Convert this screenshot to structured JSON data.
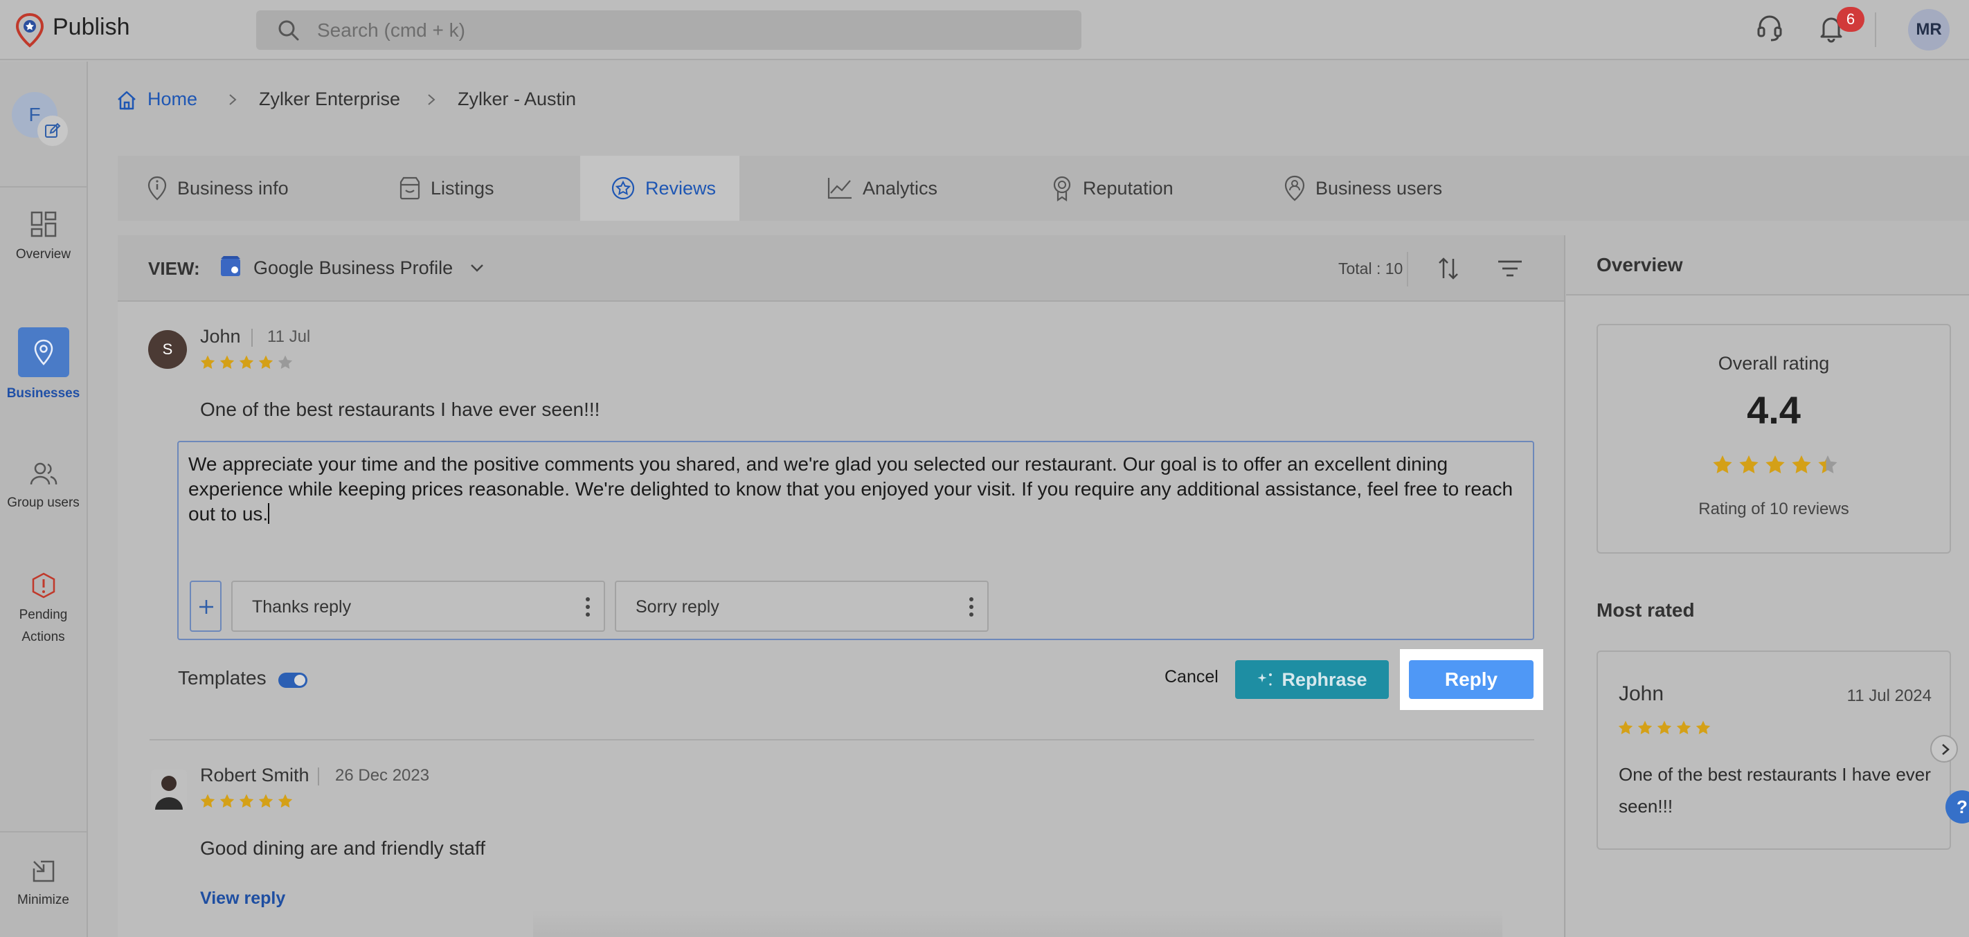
{
  "app": {
    "title": "Publish",
    "logo_icon": "publish-logo-icon"
  },
  "search": {
    "placeholder": "Search (cmd + k)"
  },
  "header": {
    "notification_count": "6",
    "user_initials": "MR"
  },
  "rail": {
    "account_initial": "F",
    "items": [
      {
        "label": "Overview",
        "icon": "dashboard-icon"
      },
      {
        "label": "Businesses",
        "icon": "location-pin-icon",
        "active": true
      },
      {
        "label": "Group users",
        "icon": "users-icon"
      },
      {
        "label_line1": "Pending",
        "label_line2": "Actions",
        "icon": "alert-icon"
      }
    ],
    "minimize_label": "Minimize"
  },
  "breadcrumb": [
    "Home",
    "Zylker Enterprise",
    "Zylker - Austin"
  ],
  "tabs": [
    {
      "label": "Business info",
      "icon": "info-pin-icon"
    },
    {
      "label": "Listings",
      "icon": "store-icon"
    },
    {
      "label": "Reviews",
      "icon": "star-badge-icon",
      "active": true
    },
    {
      "label": "Analytics",
      "icon": "line-chart-icon"
    },
    {
      "label": "Reputation",
      "icon": "award-icon"
    },
    {
      "label": "Business users",
      "icon": "user-pin-icon"
    }
  ],
  "view": {
    "label": "VIEW:",
    "value": "Google Business Profile",
    "total": "Total : 10"
  },
  "reviews": [
    {
      "avatar_initial": "S",
      "name": "John",
      "date": "11 Jul",
      "rating": 4,
      "text": "One of the best restaurants I have ever seen!!!"
    },
    {
      "name": "Robert Smith",
      "date": "26 Dec 2023",
      "rating": 5,
      "text": "Good dining are and friendly staff",
      "view_reply": "View reply"
    }
  ],
  "reply_editor": {
    "text": "We appreciate your time and the positive comments you shared, and we're glad you selected our restaurant. Our goal is to offer an excellent dining experience while keeping prices reasonable. We're delighted to know that you enjoyed your visit. If you require any additional assistance, feel free to reach out to us.",
    "templates": [
      "Thanks reply",
      "Sorry reply"
    ],
    "templates_label": "Templates",
    "templates_enabled": true,
    "cancel": "Cancel",
    "rephrase": "Rephrase",
    "reply": "Reply"
  },
  "overview": {
    "title": "Overview",
    "overall_label": "Overall rating",
    "overall_value": "4.4",
    "rating_caption": "Rating of 10 reviews",
    "most_rated_label": "Most rated",
    "most_rated": {
      "name": "John",
      "date": "11 Jul 2024",
      "rating": 5,
      "text": "One of the best restaurants I have ever seen!!!"
    }
  },
  "colors": {
    "accent_blue": "#1e56b3",
    "star": "#d4a017",
    "reply_button": "#4f98f6",
    "rephrase_button": "#1e8ea3",
    "badge_red": "#d13a3a"
  }
}
